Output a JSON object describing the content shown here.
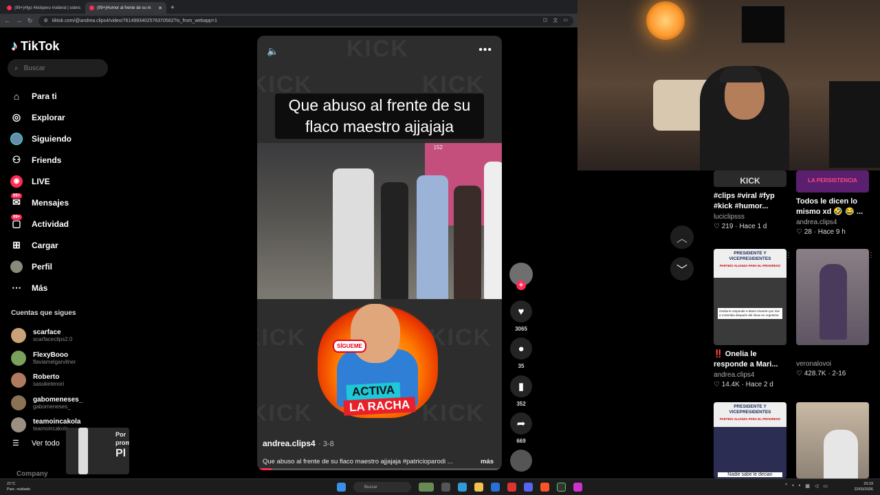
{
  "browser": {
    "tabs": [
      {
        "label": "(99+)#fyp #kickperu #sideral | siderc"
      },
      {
        "label": "(99+)Humor al frente de su m"
      }
    ],
    "new_tab": "+",
    "url": "tiktok.com/@andrea.clips4/video/7614993402576370562?is_from_webapp=1"
  },
  "sidebar": {
    "brand": "TikTok",
    "search_placeholder": "Buscar",
    "menu": [
      {
        "label": "Para ti",
        "icon": "home-icon"
      },
      {
        "label": "Explorar",
        "icon": "compass-icon"
      },
      {
        "label": "Siguiendo",
        "icon": "following-avatar-icon"
      },
      {
        "label": "Friends",
        "icon": "friends-icon"
      },
      {
        "label": "LIVE",
        "icon": "live-icon"
      },
      {
        "label": "Mensajes",
        "icon": "messages-icon",
        "badge": "99+"
      },
      {
        "label": "Actividad",
        "icon": "activity-icon",
        "badge": "99+"
      },
      {
        "label": "Cargar",
        "icon": "upload-icon"
      },
      {
        "label": "Perfil",
        "icon": "profile-icon"
      },
      {
        "label": "Más",
        "icon": "more-icon"
      }
    ],
    "following_title": "Cuentas que sigues",
    "following": [
      {
        "name": "scarface",
        "user": "scarfaceclips2.0",
        "color": "#c9a27a"
      },
      {
        "name": "FlexyBooo",
        "user": "flaviamelgarvilner",
        "color": "#7ba05b"
      },
      {
        "name": "Roberto",
        "user": "sasuketenori",
        "color": "#b07a60"
      },
      {
        "name": "gabomeneses_",
        "user": "gabomeneses_",
        "color": "#8a7355"
      },
      {
        "name": "teamoincakola",
        "user": "teamoincakola",
        "color": "#9a8f80"
      }
    ],
    "see_all": "Ver todo",
    "company": "Company",
    "floating_text": [
      "Por",
      "prom",
      "Pl"
    ]
  },
  "video": {
    "caption": "Que abuso al frente de su flaco maestro ajjajaja",
    "bg_word": "KICK",
    "scene_number": "152",
    "promo": {
      "sticker": "SÍGUEME",
      "line1": "ACTIVA",
      "line2": "LA RACHA"
    },
    "author": "andrea.clips4",
    "date": "· 3-8",
    "description": "Que abuso al frente de su flaco maestro ajjajaja #patricioparodi ...",
    "more": "más",
    "progress": 0.06
  },
  "actions": {
    "likes": "3065",
    "comments": "35",
    "saves": "352",
    "shares": "669"
  },
  "grid": [
    {
      "title": "#clips #viral #fyp #kick #humor...",
      "author": "luciclipsss",
      "likes": "219",
      "when": "Hace 1 d",
      "thumb_text": "KICK"
    },
    {
      "title": "Todos le dicen lo mismo xd 🤣 😂 ...",
      "author": "andrea.clips4",
      "likes": "28",
      "when": "Hace 9 h",
      "thumb_text": "LA PERSISTENCIA"
    },
    {
      "title": "‼️ Onelia le responde a Mari...",
      "author": "andrea.clips4",
      "likes": "14.4K",
      "when": "Hace 2 d",
      "thumb_text": "PRESIDENTE Y VICEPRESIDENTES",
      "thumb_sub": "PARTIDO ALIANZA PARA EL PROGRESO",
      "thumb_caption": "Onelia le responde a Mario Irivarren por irse a Colombia después del show en Argentina"
    },
    {
      "title": "",
      "author": "veronalovoi",
      "likes": "428.7K",
      "when": "2-16"
    },
    {
      "thumb_text": "PRESIDENTE Y VICEPRESIDENTES",
      "thumb_sub": "PARTIDO ALIANZA PARA EL PROGRESO",
      "thumb_caption": "Nadie sabe le decian"
    },
    {}
  ],
  "taskbar": {
    "weather_temp": "21°C",
    "weather_desc": "Parc. nublado",
    "search": "Buscar",
    "time": "23:33",
    "date": "22/03/2026"
  }
}
